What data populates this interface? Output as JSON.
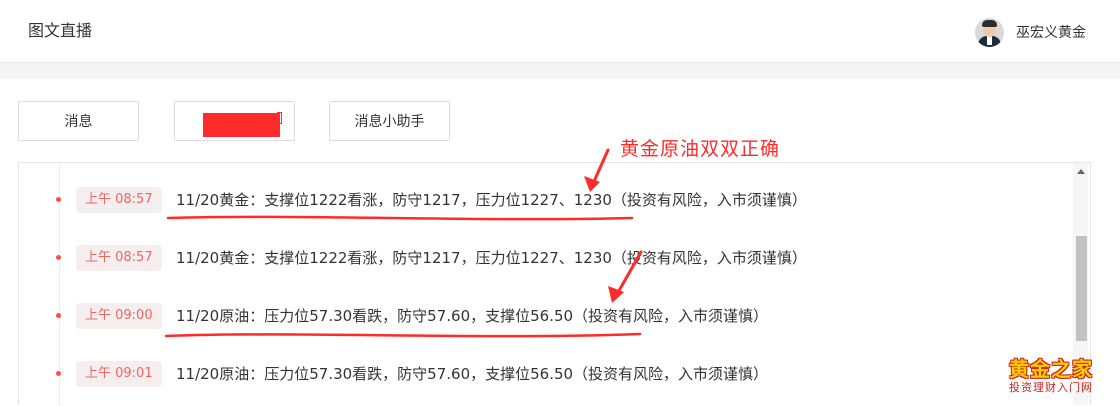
{
  "header": {
    "title": "图文直播",
    "user_name": "巫宏义黄金"
  },
  "tabs": [
    {
      "label": "消息"
    },
    {
      "label": ""
    },
    {
      "label": "消息小助手"
    }
  ],
  "timeline": [
    {
      "time": "上午 08:57",
      "text": "11/20黄金：支撑位1222看涨，防守1217，压力位1227、1230（投资有风险，入市须谨慎）"
    },
    {
      "time": "上午 08:57",
      "text": "11/20黄金：支撑位1222看涨，防守1217，压力位1227、1230（投资有风险，入市须谨慎）"
    },
    {
      "time": "上午 09:00",
      "text": "11/20原油：压力位57.30看跌，防守57.60，支撑位56.50（投资有风险，入市须谨慎）"
    },
    {
      "time": "上午 09:01",
      "text": "11/20原油：压力位57.30看跌，防守57.60，支撑位56.50（投资有风险，入市须谨慎）"
    }
  ],
  "annotation": {
    "text": "黄金原油双双正确",
    "color": "#ff2a2a"
  },
  "watermark": {
    "line1": "黄金之家",
    "line2": "投资理财入门网"
  },
  "colors": {
    "accent": "#f0665f",
    "time_bg": "#f5eeee",
    "dot": "#ff4d4d",
    "redaction": "#ff2a2a"
  },
  "icons": {
    "user_avatar": "avatar",
    "scroll_up": "scroll-up-arrow"
  }
}
